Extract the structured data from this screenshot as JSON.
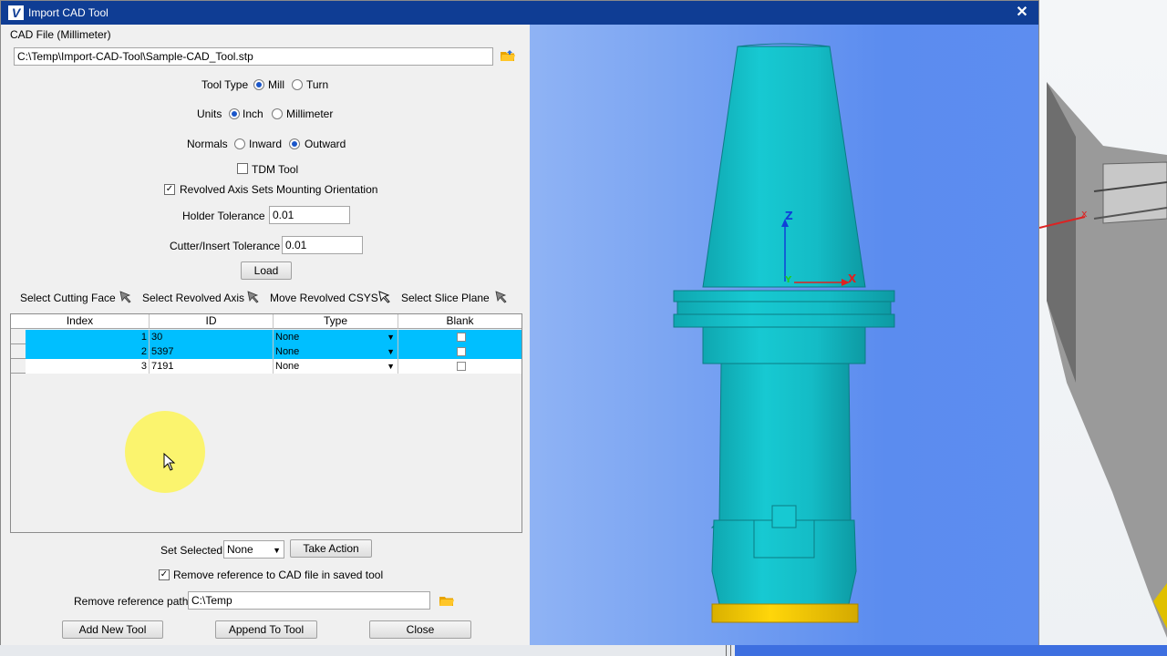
{
  "window": {
    "title": "Import CAD Tool",
    "app_logo": "V"
  },
  "cad_file": {
    "label": "CAD File (Millimeter)",
    "path": "C:\\Temp\\Import-CAD-Tool\\Sample-CAD_Tool.stp"
  },
  "tool_type": {
    "label": "Tool Type",
    "option_mill": "Mill",
    "option_turn": "Turn",
    "selected": "Mill"
  },
  "units": {
    "label": "Units",
    "option_inch": "Inch",
    "option_mm": "Millimeter",
    "selected": "Inch"
  },
  "normals": {
    "label": "Normals",
    "option_inward": "Inward",
    "option_outward": "Outward",
    "selected": "Outward"
  },
  "tdm_tool": {
    "label": "TDM Tool",
    "checked": false
  },
  "revolved_axis": {
    "label": "Revolved Axis Sets Mounting Orientation",
    "checked": true
  },
  "holder_tolerance": {
    "label": "Holder Tolerance",
    "value": "0.01"
  },
  "cutter_tolerance": {
    "label": "Cutter/Insert Tolerance",
    "value": "0.01"
  },
  "load_button": "Load",
  "selectors": {
    "cutting_face": "Select Cutting Face",
    "revolved_axis": "Select Revolved Axis",
    "move_csys": "Move Revolved CSYS",
    "slice_plane": "Select Slice Plane"
  },
  "table": {
    "headers": [
      "Index",
      "ID",
      "Type",
      "Blank"
    ],
    "rows": [
      {
        "index": "1",
        "id": "30",
        "type": "None",
        "selected": true
      },
      {
        "index": "2",
        "id": "5397",
        "type": "None",
        "selected": true
      },
      {
        "index": "3",
        "id": "7191",
        "type": "None",
        "selected": false
      }
    ]
  },
  "set_selected": {
    "label": "Set Selected",
    "value": "None",
    "action_button": "Take Action"
  },
  "remove_reference": {
    "label": "Remove reference to CAD file in saved tool",
    "checked": true
  },
  "remove_path": {
    "label": "Remove reference path",
    "value": "C:\\Temp"
  },
  "footer": {
    "add_new": "Add New Tool",
    "append": "Append To Tool",
    "close": "Close"
  },
  "viewport": {
    "axis_z": "Z",
    "axis_x": "X",
    "axis_y": "Y"
  },
  "colors": {
    "titlebar": "#0f3d94",
    "selection": "#00bfff",
    "tool_body": "#16c6cf",
    "tool_tip": "#f2cc00"
  }
}
